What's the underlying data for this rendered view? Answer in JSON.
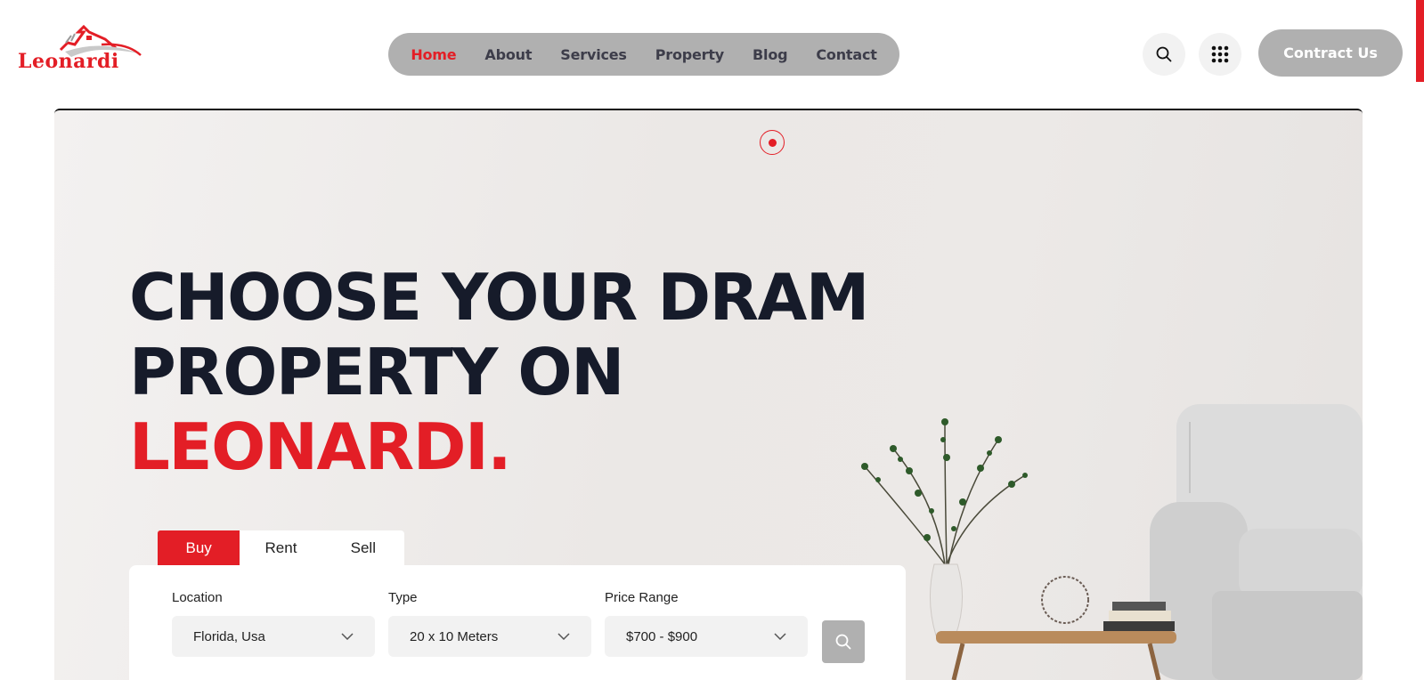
{
  "brand": {
    "name": "Leonardi",
    "accent": "#e31e26"
  },
  "nav": {
    "items": [
      {
        "label": "Home",
        "active": true
      },
      {
        "label": "About"
      },
      {
        "label": "Services"
      },
      {
        "label": "Property"
      },
      {
        "label": "Blog"
      },
      {
        "label": "Contact"
      }
    ]
  },
  "header": {
    "search_icon": "search-icon",
    "grid_icon": "grid-dots-icon",
    "cta_label": "Contract Us"
  },
  "hero": {
    "line1": "CHOOSE YOUR DRAM",
    "line2": "PROPERTY ON",
    "line3": "LEONARDI."
  },
  "search": {
    "tabs": [
      {
        "label": "Buy",
        "active": true
      },
      {
        "label": "Rent"
      },
      {
        "label": "Sell"
      }
    ],
    "fields": [
      {
        "label": "Location",
        "value": "Florida, Usa"
      },
      {
        "label": "Type",
        "value": "20 x 10 Meters"
      },
      {
        "label": "Price Range",
        "value": "$700 - $900"
      }
    ]
  }
}
